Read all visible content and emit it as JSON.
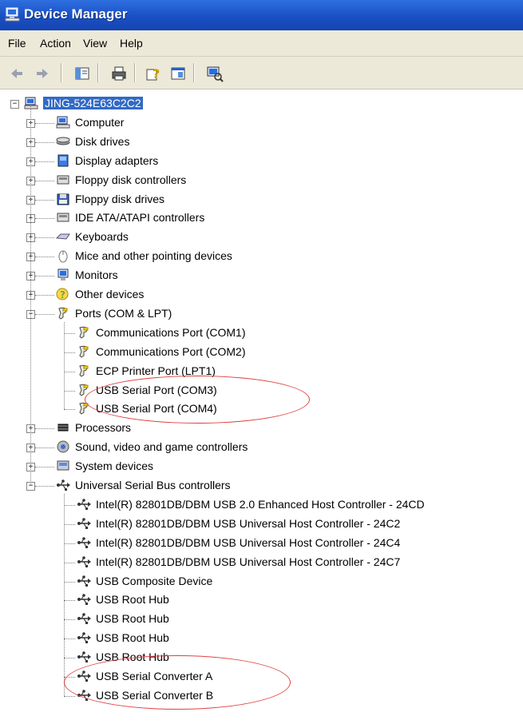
{
  "window": {
    "title": "Device Manager"
  },
  "menu": [
    "File",
    "Action",
    "View",
    "Help"
  ],
  "toolbar": {
    "buttons": [
      "back-icon",
      "forward-icon",
      "show-hide-console-tree-icon",
      "print-icon",
      "help-icon",
      "properties-icon",
      "scan-hardware-icon"
    ]
  },
  "tree": {
    "root": {
      "label": "JING-524E63C2C2",
      "icon": "computer-icon"
    },
    "categories": [
      {
        "label": "Computer",
        "icon": "computer-icon",
        "expanded": false,
        "children": []
      },
      {
        "label": "Disk drives",
        "icon": "disk-drive-icon",
        "expanded": false,
        "children": []
      },
      {
        "label": "Display adapters",
        "icon": "display-adapter-icon",
        "expanded": false,
        "children": []
      },
      {
        "label": "Floppy disk controllers",
        "icon": "floppy-controller-icon",
        "expanded": false,
        "children": []
      },
      {
        "label": "Floppy disk drives",
        "icon": "floppy-drive-icon",
        "expanded": false,
        "children": []
      },
      {
        "label": "IDE ATA/ATAPI controllers",
        "icon": "ide-controller-icon",
        "expanded": false,
        "children": []
      },
      {
        "label": "Keyboards",
        "icon": "keyboard-icon",
        "expanded": false,
        "children": []
      },
      {
        "label": "Mice and other pointing devices",
        "icon": "mouse-icon",
        "expanded": false,
        "children": []
      },
      {
        "label": "Monitors",
        "icon": "monitor-icon",
        "expanded": false,
        "children": []
      },
      {
        "label": "Other devices",
        "icon": "unknown-device-icon",
        "expanded": false,
        "children": []
      },
      {
        "label": "Ports (COM & LPT)",
        "icon": "port-icon",
        "expanded": true,
        "children": [
          {
            "label": "Communications Port (COM1)",
            "icon": "port-icon"
          },
          {
            "label": "Communications Port (COM2)",
            "icon": "port-icon"
          },
          {
            "label": "ECP Printer Port (LPT1)",
            "icon": "port-icon"
          },
          {
            "label": "USB Serial Port (COM3)",
            "icon": "port-icon"
          },
          {
            "label": "USB Serial Port (COM4)",
            "icon": "port-icon"
          }
        ]
      },
      {
        "label": "Processors",
        "icon": "processor-icon",
        "expanded": false,
        "children": []
      },
      {
        "label": "Sound, video and game controllers",
        "icon": "sound-icon",
        "expanded": false,
        "children": []
      },
      {
        "label": "System devices",
        "icon": "system-device-icon",
        "expanded": false,
        "children": []
      },
      {
        "label": "Universal Serial Bus controllers",
        "icon": "usb-icon",
        "expanded": true,
        "children": [
          {
            "label": "Intel(R) 82801DB/DBM USB 2.0 Enhanced Host Controller - 24CD",
            "icon": "usb-icon"
          },
          {
            "label": "Intel(R) 82801DB/DBM USB Universal Host Controller - 24C2",
            "icon": "usb-icon"
          },
          {
            "label": "Intel(R) 82801DB/DBM USB Universal Host Controller - 24C4",
            "icon": "usb-icon"
          },
          {
            "label": "Intel(R) 82801DB/DBM USB Universal Host Controller - 24C7",
            "icon": "usb-icon"
          },
          {
            "label": "USB Composite Device",
            "icon": "usb-icon"
          },
          {
            "label": "USB Root Hub",
            "icon": "usb-icon"
          },
          {
            "label": "USB Root Hub",
            "icon": "usb-icon"
          },
          {
            "label": "USB Root Hub",
            "icon": "usb-icon"
          },
          {
            "label": "USB Root Hub",
            "icon": "usb-icon"
          },
          {
            "label": "USB Serial Converter A",
            "icon": "usb-icon"
          },
          {
            "label": "USB Serial Converter B",
            "icon": "usb-icon"
          }
        ]
      }
    ]
  },
  "colors": {
    "titlebar": "#1a4fc4",
    "selection": "#316ac5",
    "highlight_circle": "#e04040",
    "chrome": "#ece9d8"
  }
}
